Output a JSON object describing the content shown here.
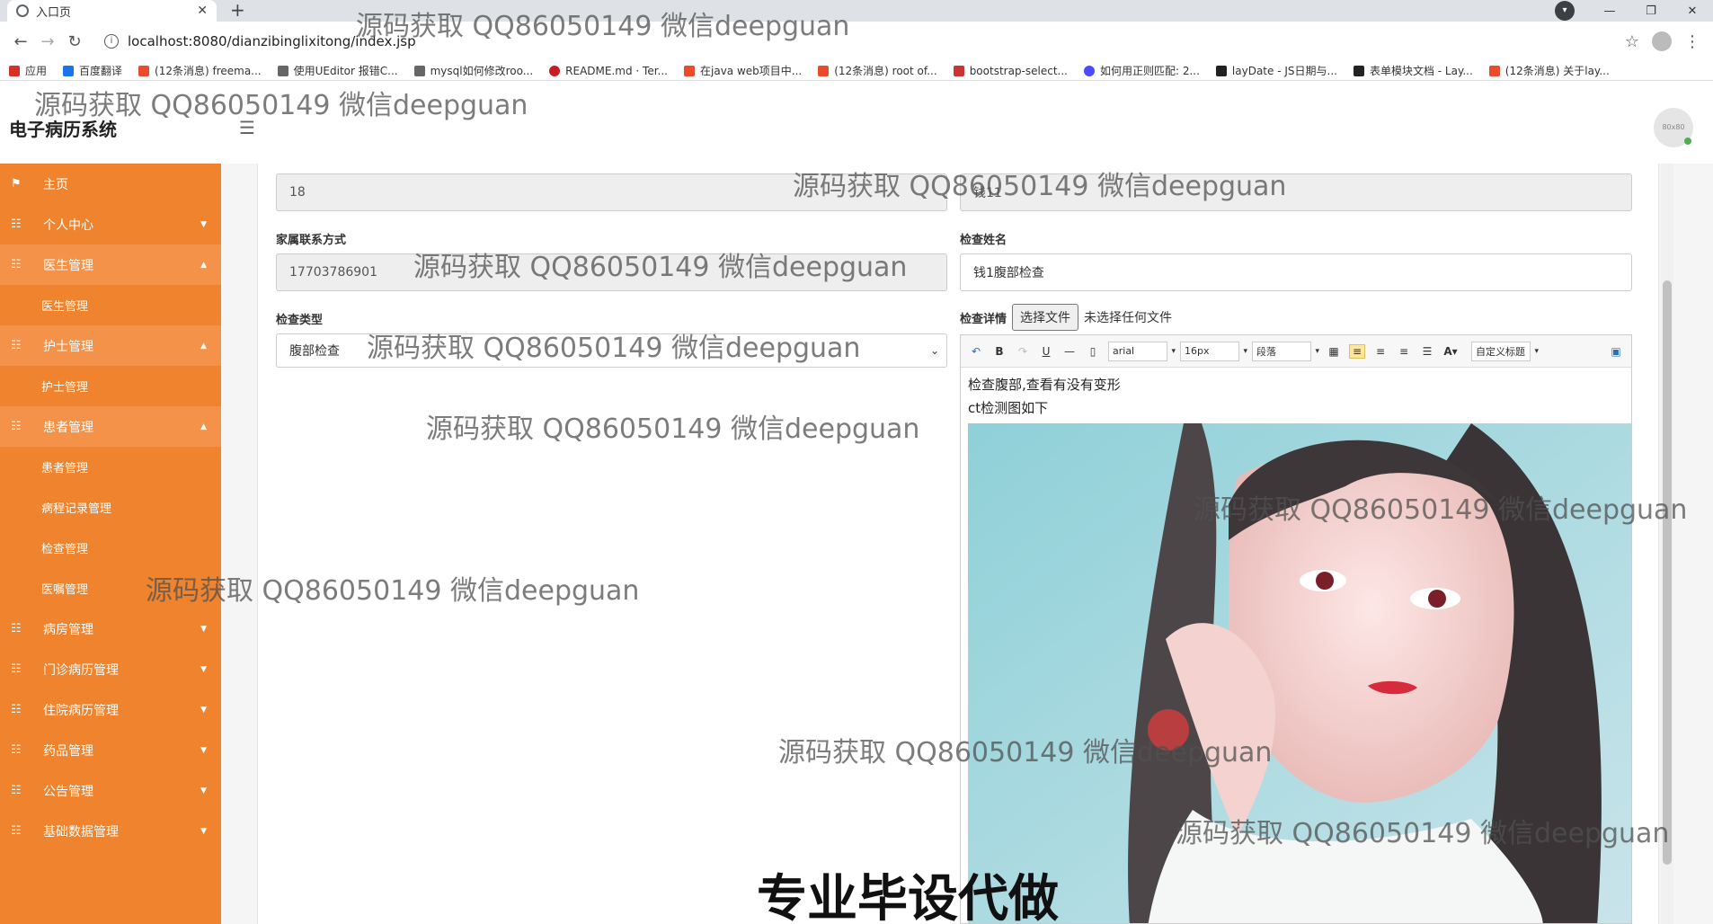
{
  "browser": {
    "tab_title": "入口页",
    "url": "localhost:8080/dianzibinglixitong/index.jsp",
    "bookmarks": [
      {
        "label": "应用",
        "color": "#d93025"
      },
      {
        "label": "百度翻译",
        "color": "#1a73e8"
      },
      {
        "label": "(12条消息) freema...",
        "color": "#e94c2b"
      },
      {
        "label": "使用UEditor 报错C...",
        "color": "#666666"
      },
      {
        "label": "mysql如何修改roo...",
        "color": "#666666"
      },
      {
        "label": "README.md · Ter...",
        "color": "#c71d23"
      },
      {
        "label": "在java web项目中...",
        "color": "#e94c2b"
      },
      {
        "label": "(12条消息) root of...",
        "color": "#e94c2b"
      },
      {
        "label": "bootstrap-select...",
        "color": "#cc3333"
      },
      {
        "label": "如何用正则匹配: 2...",
        "color": "#4a4aff"
      },
      {
        "label": "layDate - JS日期与...",
        "color": "#222222"
      },
      {
        "label": "表单模块文档 - Lay...",
        "color": "#222222"
      },
      {
        "label": "(12条消息) 关于lay...",
        "color": "#e94c2b"
      }
    ]
  },
  "header": {
    "app_title": "电子病历系统",
    "avatar_text": "80x80"
  },
  "sidebar": {
    "home": "主页",
    "personal": "个人中心",
    "doctor_mgmt": "医生管理",
    "doctor_sub": "医生管理",
    "nurse_mgmt": "护士管理",
    "nurse_sub": "护士管理",
    "patient_mgmt": "患者管理",
    "patient_sub": "患者管理",
    "course_sub": "病程记录管理",
    "exam_sub": "检查管理",
    "order_sub": "医嘱管理",
    "ward_mgmt": "病房管理",
    "outpatient_mgmt": "门诊病历管理",
    "inpatient_mgmt": "住院病历管理",
    "drug_mgmt": "药品管理",
    "notice_mgmt": "公告管理",
    "base_mgmt": "基础数据管理"
  },
  "form": {
    "age_value": "18",
    "name_value": "钱11",
    "family_contact_label": "家属联系方式",
    "family_contact_value": "17703786901",
    "exam_name_label": "检查姓名",
    "exam_name_value": "钱1腹部检查",
    "exam_type_label": "检查类型",
    "exam_type_value": "腹部检查",
    "exam_detail_label": "检查详情",
    "file_button": "选择文件",
    "file_status": "未选择任何文件"
  },
  "editor": {
    "font": "arial",
    "size": "16px",
    "paragraph": "段落",
    "custom_title": "自定义标题",
    "line1": "检查腹部,查看有没有变形",
    "line2": "ct检测图如下"
  },
  "watermarks": {
    "text": "源码获取 QQ86050149 微信deepguan",
    "big": "专业毕设代做"
  }
}
